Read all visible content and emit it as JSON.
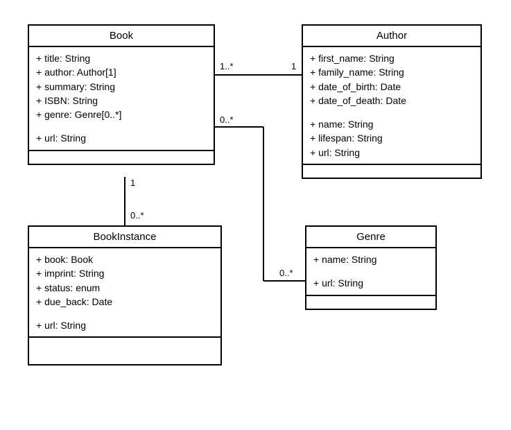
{
  "classes": {
    "book": {
      "title": "Book",
      "a1": "+ title: String",
      "a2": "+ author: Author[1]",
      "a3": "+ summary: String",
      "a4": "+ ISBN: String",
      "a5": "+ genre: Genre[0..*]",
      "a6": "+ url: String"
    },
    "author": {
      "title": "Author",
      "a1": "+ first_name: String",
      "a2": "+ family_name: String",
      "a3": "+ date_of_birth: Date",
      "a4": "+ date_of_death: Date",
      "a5": "+ name: String",
      "a6": "+ lifespan: String",
      "a7": "+ url: String"
    },
    "bookinstance": {
      "title": "BookInstance",
      "a1": "+ book: Book",
      "a2": "+ imprint: String",
      "a3": "+ status: enum",
      "a4": "+ due_back: Date",
      "a5": "+ url: String"
    },
    "genre": {
      "title": "Genre",
      "a1": "+ name: String",
      "a2": "+ url: String"
    }
  },
  "multiplicities": {
    "book_author_left": "1..*",
    "book_author_right": "1",
    "book_genre_top": "0..*",
    "book_genre_bottom": "0..*",
    "book_instance_top": "1",
    "book_instance_bottom": "0..*"
  }
}
